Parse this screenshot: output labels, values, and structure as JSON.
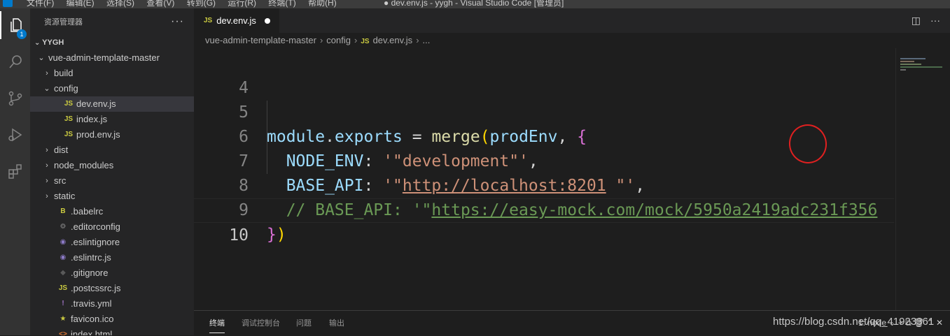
{
  "titlebar": {
    "menu": [
      "文件(F)",
      "编辑(E)",
      "选择(S)",
      "查看(V)",
      "转到(G)",
      "运行(R)",
      "终端(T)",
      "帮助(H)"
    ],
    "title": "● dev.env.js - yygh - Visual Studio Code [管理员]"
  },
  "activity_bar": {
    "items": [
      "files-icon",
      "search-icon",
      "source-control-icon",
      "run-debug-icon",
      "extensions-icon"
    ],
    "badge": "1"
  },
  "sidebar": {
    "title": "资源管理器",
    "more": "···",
    "root": "YYGH",
    "items": [
      {
        "label": "vue-admin-template-master",
        "chev": "⌄",
        "icon": "",
        "depth": 1
      },
      {
        "label": "build",
        "chev": "›",
        "icon": "",
        "depth": 2
      },
      {
        "label": "config",
        "chev": "⌄",
        "icon": "",
        "depth": 2
      },
      {
        "label": "dev.env.js",
        "chev": "",
        "icon": "JS",
        "depth": 3,
        "selected": true
      },
      {
        "label": "index.js",
        "chev": "",
        "icon": "JS",
        "depth": 3
      },
      {
        "label": "prod.env.js",
        "chev": "",
        "icon": "JS",
        "depth": 3
      },
      {
        "label": "dist",
        "chev": "›",
        "icon": "",
        "depth": 2
      },
      {
        "label": "node_modules",
        "chev": "›",
        "icon": "",
        "depth": 2
      },
      {
        "label": "src",
        "chev": "›",
        "icon": "",
        "depth": 2
      },
      {
        "label": "static",
        "chev": "›",
        "icon": "",
        "depth": 2
      },
      {
        "label": ".babelrc",
        "chev": "",
        "icon": "B",
        "depth": 2
      },
      {
        "label": ".editorconfig",
        "chev": "",
        "icon": "⚙",
        "depth": 2
      },
      {
        "label": ".eslintignore",
        "chev": "",
        "icon": "◉",
        "depth": 2
      },
      {
        "label": ".eslintrc.js",
        "chev": "",
        "icon": "◉",
        "depth": 2
      },
      {
        "label": ".gitignore",
        "chev": "",
        "icon": "◆",
        "depth": 2
      },
      {
        "label": ".postcssrc.js",
        "chev": "",
        "icon": "JS",
        "depth": 2
      },
      {
        "label": ".travis.yml",
        "chev": "",
        "icon": "!",
        "depth": 2
      },
      {
        "label": "favicon.ico",
        "chev": "",
        "icon": "★",
        "depth": 2
      },
      {
        "label": "index.html",
        "chev": "",
        "icon": "<>",
        "depth": 2
      }
    ]
  },
  "editor": {
    "tab": {
      "icon": "JS",
      "label": "dev.env.js"
    },
    "breadcrumb": [
      "vue-admin-template-master",
      "config",
      "dev.env.js",
      "..."
    ],
    "line_numbers": [
      "4",
      "5",
      "6",
      "7",
      "8",
      "9",
      "10"
    ],
    "code": {
      "l5": {
        "a": "module",
        "b": ".",
        "c": "exports",
        "d": " = ",
        "e": "merge",
        "f": "(",
        "g": "prodEnv",
        "h": ", ",
        "i": "{"
      },
      "l6": {
        "a": "  NODE_ENV",
        "b": ": ",
        "c": "'\"development\"'",
        "d": ","
      },
      "l7": {
        "a": "  BASE_API",
        "b": ": ",
        "c": "'\"",
        "d": "http://localhost:8201",
        "e": " \"'",
        "f": ","
      },
      "l8": {
        "a": "  // BASE_API: '\"",
        "b": "https://easy-mock.com/mock/5950a2419adc231f356"
      },
      "l9": {
        "a": "}",
        "b": ")"
      }
    }
  },
  "panel": {
    "tabs": [
      "终端",
      "调试控制台",
      "问题",
      "输出"
    ],
    "active_tab": "终端",
    "tools": "1: node  ⌄  +  ⧉  🗑  ⌃  ✕"
  },
  "watermark": "https://blog.csdn.net/qq_41923361",
  "colors": {
    "activity_bar": "#333333",
    "sidebar": "#252526",
    "editor": "#1e1e1e",
    "accent": "#007acc",
    "js_icon": "#cbcb41",
    "annotation": "#e02020"
  }
}
